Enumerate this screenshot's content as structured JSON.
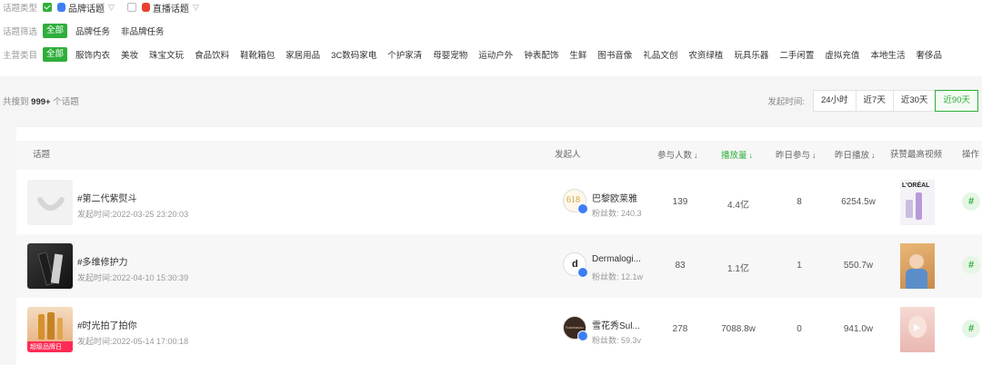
{
  "filters": {
    "topic_type_label": "话题类型",
    "topic_types": [
      {
        "label": "品牌话题",
        "checked": true
      },
      {
        "label": "直播话题",
        "checked": false
      }
    ],
    "topic_filter_label": "话题筛选",
    "topic_filter_options": [
      "全部",
      "品牌任务",
      "非品牌任务"
    ],
    "category_label": "主营类目",
    "categories": [
      "全部",
      "服饰内衣",
      "美妆",
      "珠宝文玩",
      "食品饮料",
      "鞋靴箱包",
      "家居用品",
      "3C数码家电",
      "个护家清",
      "母婴宠物",
      "运动户外",
      "钟表配饰",
      "生鲜",
      "图书音像",
      "礼品文创",
      "农资绿植",
      "玩具乐器",
      "二手闲置",
      "虚拟充值",
      "本地生活",
      "奢侈品"
    ]
  },
  "summary": {
    "prefix": "共搜到",
    "count": "999+",
    "suffix": "个话题"
  },
  "time_filter": {
    "label": "发起时间:",
    "options": [
      "24小时",
      "近7天",
      "近30天",
      "近90天"
    ],
    "active_index": 3
  },
  "table": {
    "headers": {
      "topic": "话题",
      "creator": "发起人",
      "participants": "参与人数",
      "plays": "播放量",
      "yesterday_participants": "昨日参与",
      "yesterday_plays": "昨日播放",
      "top_video": "获赞最高视频",
      "action": "操作"
    },
    "sorted_column": "plays",
    "rows": [
      {
        "title": "#第二代紫熨斗",
        "time": "发起时间:2022-03-25 23:20:03",
        "creator_name": "巴黎欧莱雅",
        "creator_fans": "粉丝数: 240.3",
        "participants": "139",
        "plays": "4.4亿",
        "yesterday_participants": "8",
        "yesterday_plays": "6254.5w",
        "avatar_text": "618",
        "video_text": "L'ORÉAL"
      },
      {
        "title": "#多维修护力",
        "time": "发起时间:2022-04-10 15:30:39",
        "creator_name": "Dermalogi...",
        "creator_fans": "粉丝数: 12.1w",
        "participants": "83",
        "plays": "1.1亿",
        "yesterday_participants": "1",
        "yesterday_plays": "550.7w",
        "avatar_text": "d"
      },
      {
        "title": "#时光拍了拍你",
        "time": "发起时间:2022-05-14 17:00:18",
        "creator_name": "雪花秀Sul...",
        "creator_fans": "粉丝数: 59.3v",
        "participants": "278",
        "plays": "7088.8w",
        "yesterday_participants": "0",
        "yesterday_plays": "941.0w",
        "avatar_text": "Sulwhasoo",
        "thumb_caption": "超级品牌日"
      }
    ],
    "action_symbol": "#"
  },
  "colors": {
    "accent": "#2fae3b",
    "verify": "#3d7ef5"
  },
  "icons": {
    "brand_topic": "brand-topic-icon",
    "live_topic": "live-topic-icon",
    "verified": "verified-badge-icon",
    "sort": "sort-arrow-icon"
  }
}
